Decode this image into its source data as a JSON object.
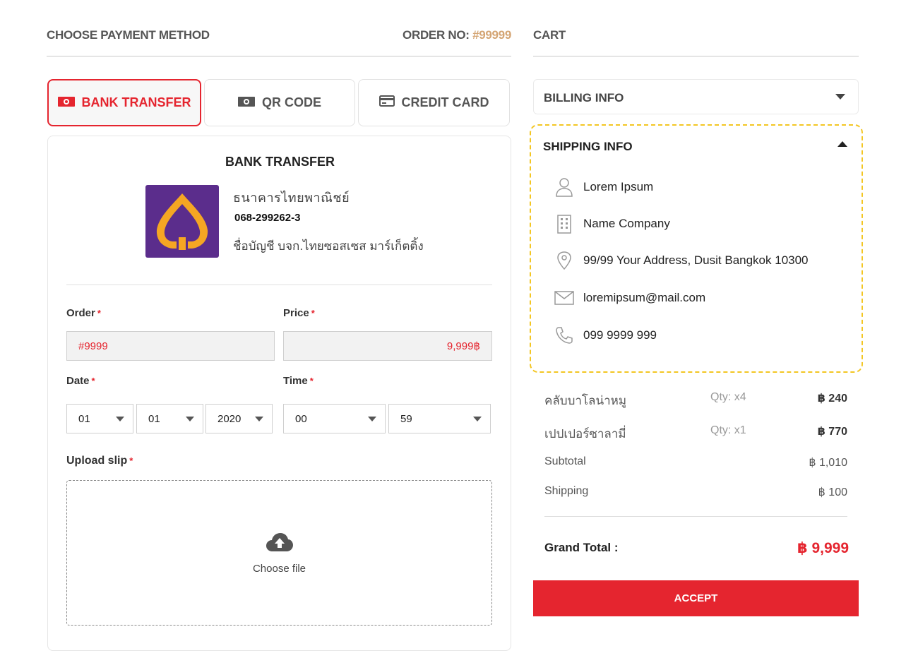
{
  "header": {
    "payment_title": "CHOOSE PAYMENT METHOD",
    "order_label": "ORDER NO:",
    "order_number": "#99999",
    "cart_title": "CART"
  },
  "tabs": [
    {
      "label": "BANK TRANSFER",
      "icon": "cash-icon",
      "active": true
    },
    {
      "label": "QR CODE",
      "icon": "cash-icon",
      "active": false
    },
    {
      "label": "CREDIT CARD",
      "icon": "credit-card-icon",
      "active": false
    }
  ],
  "bank": {
    "section_title": "BANK TRANSFER",
    "bank_name": "ธนาคารไทยพาณิชย์",
    "account_number": "068-299262-3",
    "account_holder": "ชื่อบัญชี บจก.ไทยซอสเซส มาร์เก็ตติ้ง",
    "logo_color": "#5b2d8c",
    "logo_accent": "#f5a623"
  },
  "form": {
    "order_label": "Order",
    "order_value": "#9999",
    "price_label": "Price",
    "price_value": "9,999฿",
    "date_label": "Date",
    "time_label": "Time",
    "required_mark": "*",
    "date_day": "01",
    "date_month": "01",
    "date_year": "2020",
    "time_hour": "00",
    "time_minute": "59",
    "upload_label": "Upload slip",
    "upload_button": "Choose file"
  },
  "billing": {
    "title": "BILLING INFO",
    "expanded": false
  },
  "shipping": {
    "title": "SHIPPING INFO",
    "expanded": true,
    "name": "Lorem Ipsum",
    "company": "Name Company",
    "address": "99/99 Your Address, Dusit Bangkok 10300",
    "email": "loremipsum@mail.com",
    "phone": "099 9999 999"
  },
  "cart": {
    "items": [
      {
        "name": "คลับบาโลน่าหมู",
        "qty": "Qty: x4",
        "price": "฿ 240"
      },
      {
        "name": "เปปเปอร์ซาลามี่",
        "qty": "Qty: x1",
        "price": "฿ 770"
      }
    ],
    "subtotal_label": "Subtotal",
    "subtotal_value": "฿ 1,010",
    "shipping_label": "Shipping",
    "shipping_value": "฿ 100",
    "grand_total_label": "Grand Total :",
    "grand_total_value": "฿ 9,999",
    "accept_label": "ACCEPT"
  },
  "colors": {
    "accent": "#e5252f",
    "order_number": "#d4a574",
    "highlight_border": "#f3c623"
  }
}
